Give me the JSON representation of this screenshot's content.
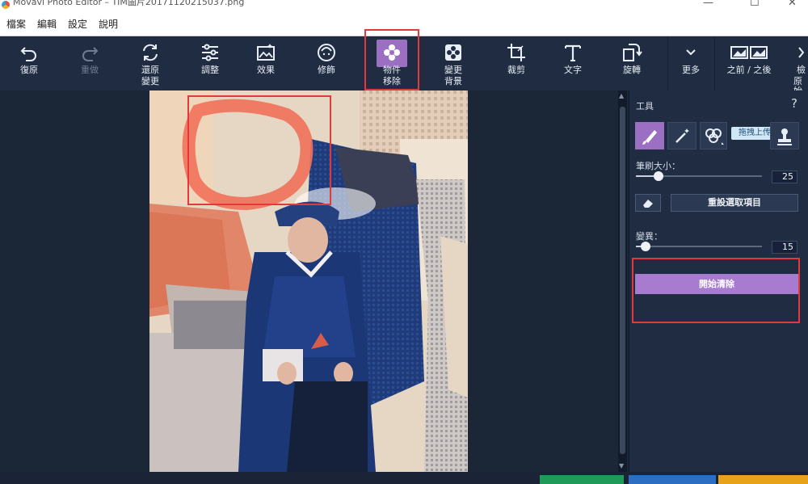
{
  "window": {
    "title": "Movavi Photo Editor – TIM圖片20171120215037.png"
  },
  "menu": [
    "檔案",
    "編輯",
    "設定",
    "說明"
  ],
  "toolbar": {
    "undo": "復原",
    "redo": "重做",
    "reset_l1": "還原",
    "reset_l2": "變更",
    "adjust": "調整",
    "effects": "效果",
    "retouch": "修飾",
    "object_removal_l1": "物件",
    "object_removal_l2": "移除",
    "change_bg_l1": "變更",
    "change_bg_l2": "背景",
    "crop": "裁剪",
    "text": "文字",
    "rotate": "旋轉",
    "more": "更多",
    "before_after": "之前 / 之後",
    "original_l1": "檢",
    "original_l2": "原始"
  },
  "panel": {
    "tools_label": "工具",
    "help": "?",
    "upload_badge": "拖拽上传",
    "brush_size_label": "筆刷大小：",
    "brush_size_value": "25",
    "brush_size_fraction": 0.18,
    "reset_selection": "重設選取項目",
    "variation_label": "變異：",
    "variation_value": "15",
    "variation_fraction": 0.08,
    "start_erase": "開始清除"
  },
  "colors": {
    "accent": "#9b6fc1",
    "highlight_box": "#e23a3a",
    "toolbar_bg": "#1f2c42"
  }
}
